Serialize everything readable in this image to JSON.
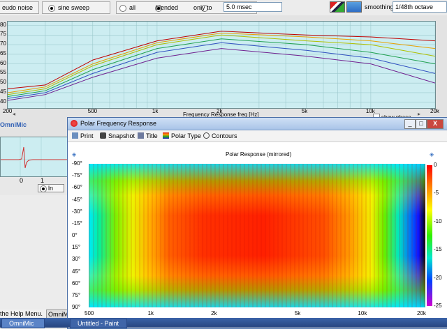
{
  "toolbar_top": {
    "pseudo_noise_label": "eudo noise",
    "sine_sweep_label": "sine sweep",
    "all_label": "all",
    "blended_label": "blended",
    "only_to_label": "only to",
    "only_to_value": "5.0 msec",
    "smoothing_label": "smoothing",
    "smoothing_value": "1/48th octave"
  },
  "freq_plot": {
    "title": "Frequency Response  freq [Hz]",
    "y_ticks": [
      "80",
      "75",
      "70",
      "65",
      "60",
      "55",
      "50",
      "45",
      "40"
    ],
    "x_ticks": [
      "200",
      "500",
      "1k",
      "2k",
      "5k",
      "10k",
      "20k"
    ],
    "show_phase_label": "show phase",
    "logo_label": "OmniMic"
  },
  "impulse_panel": {
    "x_tick": "0",
    "x_tick2": "1",
    "radio_label": "ln"
  },
  "status": {
    "help_text": "the Help Menu.",
    "omnimic_button": "OmniMic"
  },
  "polar_window": {
    "title": "Polar Frequency Response",
    "toolbar": [
      "Print",
      "Snapshot",
      "Title",
      "Polar Type",
      "Contours"
    ],
    "chart_title": "Polar Response (mirrored)",
    "y_ticks": [
      "-90°",
      "-75°",
      "-60°",
      "-45°",
      "-30°",
      "-15°",
      "0°",
      "15°",
      "30°",
      "45°",
      "60°",
      "75°",
      "90°"
    ],
    "x_ticks": [
      "500",
      "1k",
      "2k",
      "5k",
      "10k",
      "20k"
    ],
    "colorbar_ticks": [
      "0",
      "-5",
      "-10",
      "-15",
      "-20",
      "-25"
    ],
    "min_label": "_",
    "max_label": "□",
    "close_label": "X"
  },
  "taskbar": {
    "items": [
      "OmniMic",
      "Untitled - Paint"
    ]
  },
  "colors": {
    "plot_bg": "#ccedf1",
    "titlebar": "#b8cfec",
    "taskbar": "#2c4f91"
  },
  "chart_data": {
    "type": "line",
    "title": "Frequency Response  freq [Hz]",
    "xlabel": "Frequency Response  freq [Hz]",
    "ylabel": "",
    "x_scale": "log",
    "xlim": [
      200,
      20000
    ],
    "ylim": [
      37,
      82
    ],
    "series": [
      {
        "values": [
          [
            200,
            47
          ],
          [
            300,
            49
          ],
          [
            500,
            62
          ],
          [
            1000,
            72
          ],
          [
            2000,
            77
          ],
          [
            5000,
            75
          ],
          [
            10000,
            74
          ],
          [
            20000,
            72
          ]
        ]
      },
      {
        "values": [
          [
            200,
            45
          ],
          [
            300,
            48
          ],
          [
            500,
            60
          ],
          [
            1000,
            71
          ],
          [
            2000,
            76
          ],
          [
            5000,
            74
          ],
          [
            10000,
            72
          ],
          [
            20000,
            68
          ]
        ]
      },
      {
        "values": [
          [
            200,
            44
          ],
          [
            300,
            47
          ],
          [
            500,
            59
          ],
          [
            1000,
            70
          ],
          [
            2000,
            75
          ],
          [
            5000,
            72
          ],
          [
            10000,
            70
          ],
          [
            20000,
            64
          ]
        ]
      },
      {
        "values": [
          [
            200,
            43
          ],
          [
            300,
            46
          ],
          [
            500,
            57
          ],
          [
            1000,
            68
          ],
          [
            2000,
            73
          ],
          [
            5000,
            70
          ],
          [
            10000,
            66
          ],
          [
            20000,
            60
          ]
        ]
      },
      {
        "values": [
          [
            200,
            42
          ],
          [
            300,
            45
          ],
          [
            500,
            55
          ],
          [
            1000,
            66
          ],
          [
            2000,
            71
          ],
          [
            5000,
            67
          ],
          [
            10000,
            63
          ],
          [
            20000,
            55
          ]
        ]
      },
      {
        "values": [
          [
            200,
            41
          ],
          [
            300,
            44
          ],
          [
            500,
            53
          ],
          [
            1000,
            63
          ],
          [
            2000,
            68
          ],
          [
            5000,
            64
          ],
          [
            10000,
            60
          ],
          [
            20000,
            50
          ]
        ]
      }
    ]
  }
}
